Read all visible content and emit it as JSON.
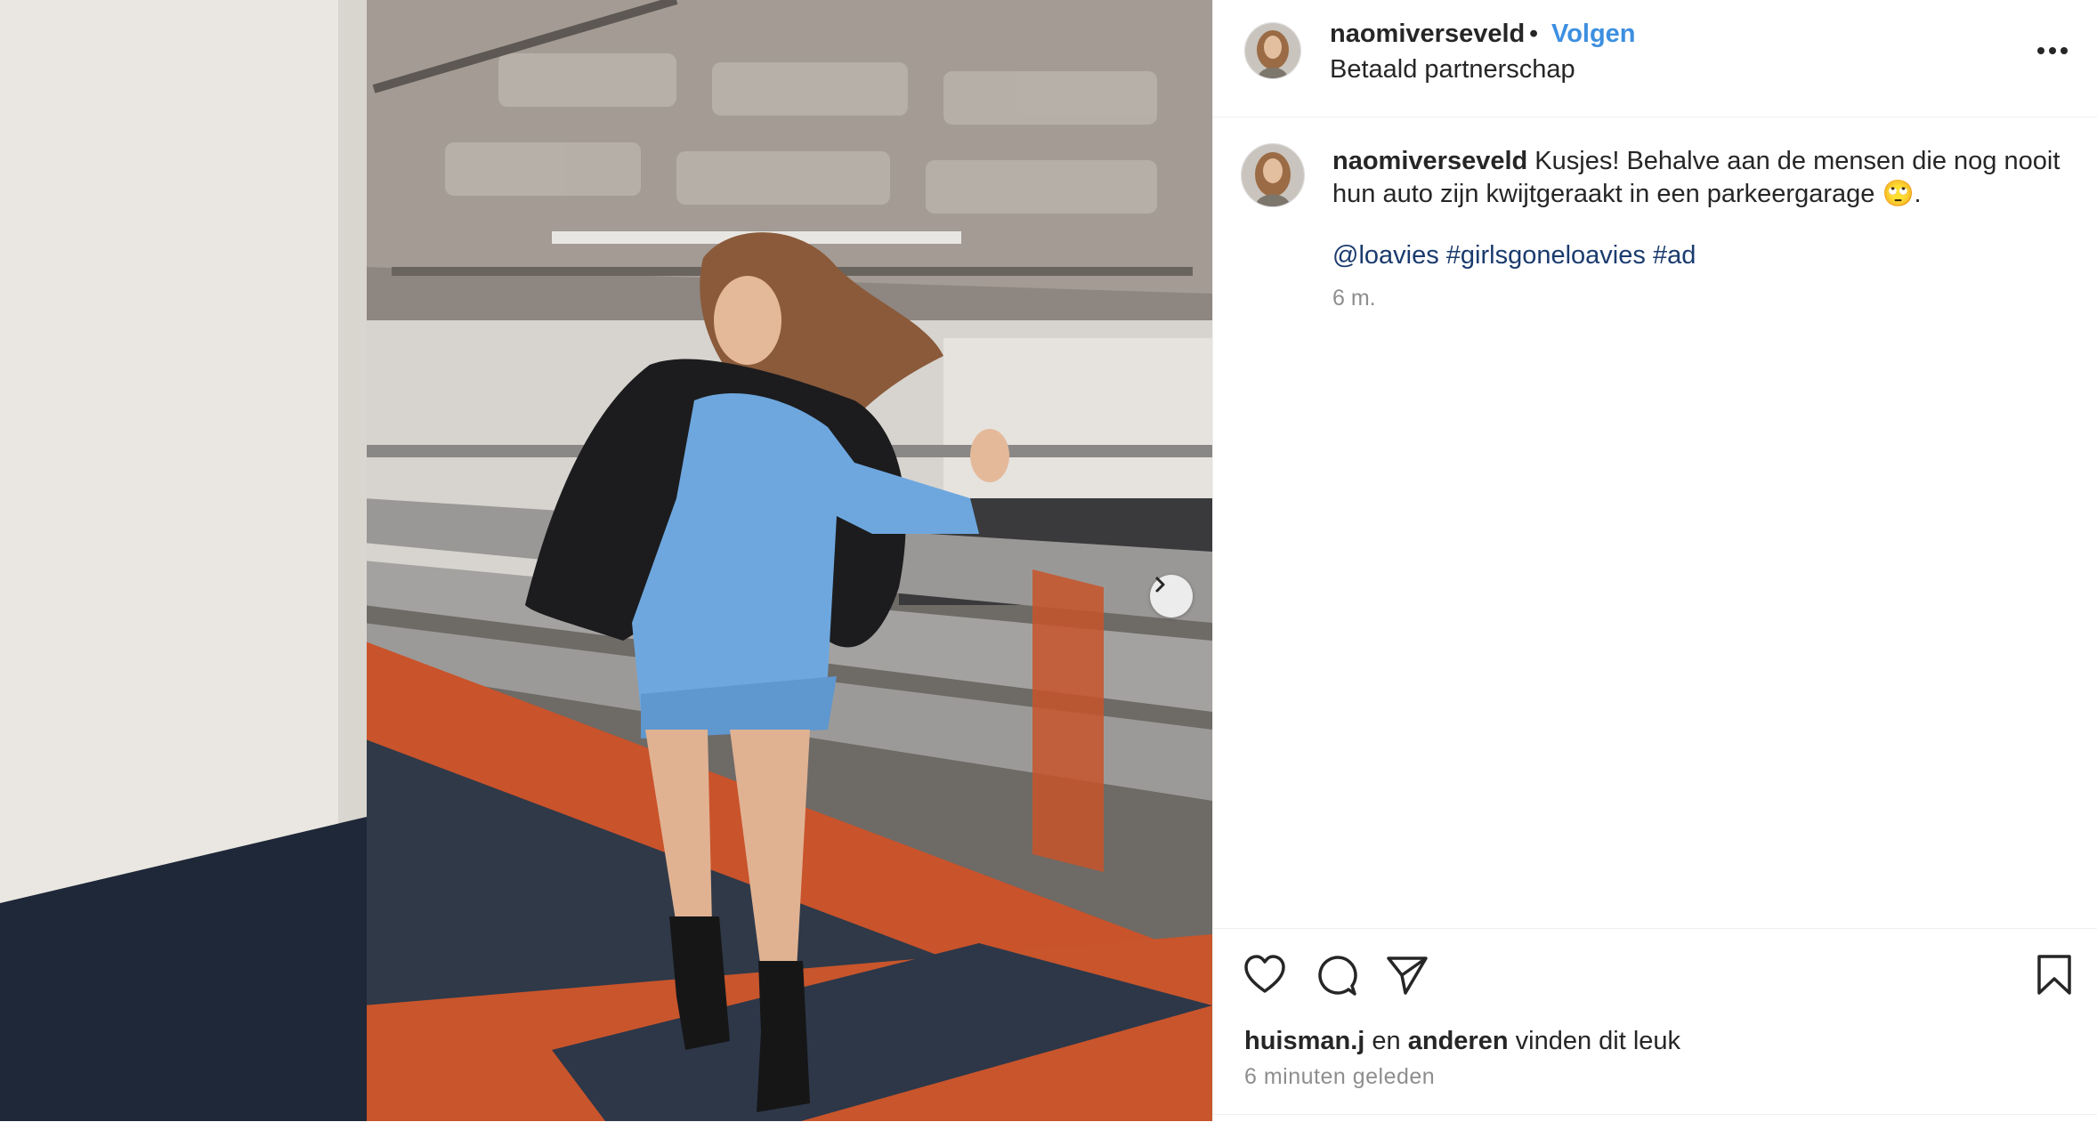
{
  "post": {
    "username": "naomiverseveld",
    "follow_label": "Volgen",
    "separator": "•",
    "subtitle": "Betaald partnerschap",
    "caption_text": "Kusjes! Behalve aan de mensen die nog nooit hun auto zijn kwijtgeraakt in een parkeergarage 🙄.",
    "tags": [
      "@loavies",
      "#girlsgoneloavies",
      "#ad"
    ],
    "caption_age": "6 m.",
    "liked_by_user": "huisman.j",
    "liked_joiner": "en",
    "liked_others": "anderen",
    "liked_suffix": "vinden dit leuk",
    "posted_ago": "6 minuten geleden"
  },
  "icons": {
    "more": "more-horizontal-icon",
    "like": "heart-icon",
    "comment": "comment-icon",
    "share": "send-icon",
    "save": "bookmark-icon",
    "next": "chevron-right-icon"
  },
  "colors": {
    "accent": "#3d8fe0",
    "tag": "#1a3b6e",
    "muted": "#8e8e8e",
    "text": "#262626"
  }
}
